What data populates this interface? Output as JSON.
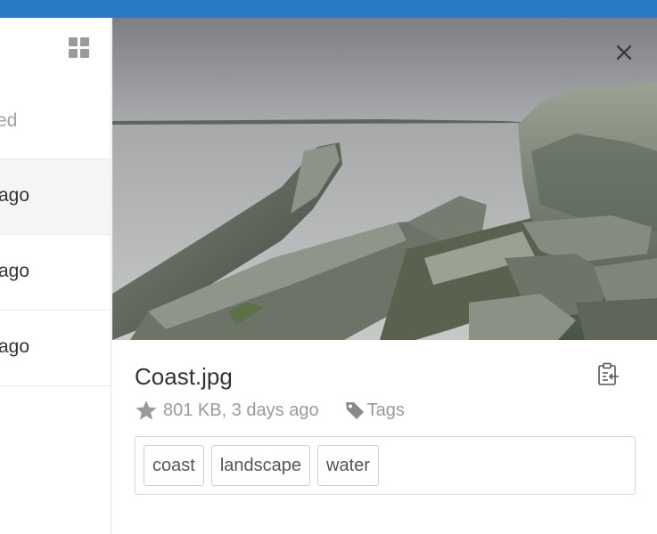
{
  "header": {
    "accent_color": "#2a7ac3"
  },
  "sidebar": {
    "view_toggle_icon": "grid-icon",
    "partial_label": "ed",
    "rows": [
      {
        "text": "ago",
        "selected": true
      },
      {
        "text": "ago",
        "selected": false
      },
      {
        "text": "ago",
        "selected": false
      }
    ]
  },
  "details": {
    "file_name": "Coast.jpg",
    "meta_text": "801 KB, 3 days ago",
    "tags_label": "Tags",
    "tags": [
      "coast",
      "landscape",
      "water"
    ],
    "icons": {
      "close": "close-icon",
      "clipboard": "clipboard-icon",
      "favorite": "star-icon",
      "tag": "tag-icon"
    }
  }
}
